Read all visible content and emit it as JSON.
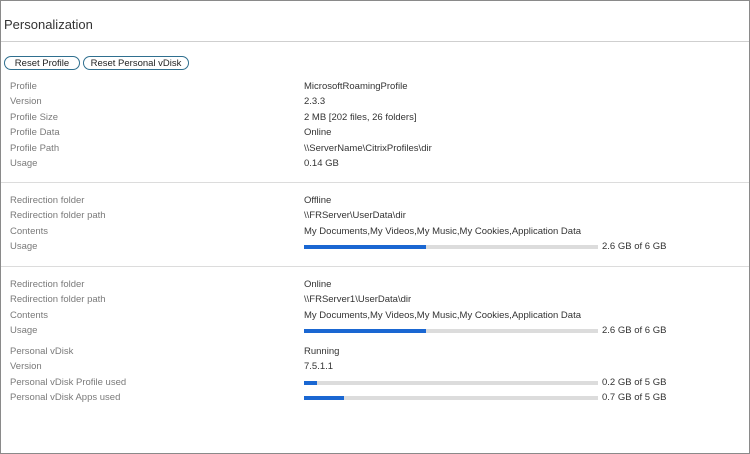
{
  "title": "Personalization",
  "buttons": {
    "reset_profile": "Reset Profile",
    "reset_vdisk": "Reset Personal vDisk"
  },
  "profile": {
    "rows": [
      {
        "label": "Profile",
        "value": "MicrosoftRoamingProfile"
      },
      {
        "label": "Version",
        "value": "2.3.3"
      },
      {
        "label": "Profile Size",
        "value": "2 MB [202 files, 26 folders]"
      },
      {
        "label": "Profile Data",
        "value": "Online"
      },
      {
        "label": "Profile Path",
        "value": "\\\\ServerName\\CitrixProfiles\\dir"
      },
      {
        "label": "Usage",
        "value": "0.14 GB"
      }
    ]
  },
  "redirection1": {
    "rows": [
      {
        "label": "Redirection folder",
        "value": "Offline"
      },
      {
        "label": "Redirection folder path",
        "value": "\\\\FRServer\\UserData\\dir"
      },
      {
        "label": "Contents",
        "value": "My Documents,My Videos,My Music,My Cookies,Application Data"
      }
    ],
    "usage": {
      "label": "Usage",
      "text": "2.6 GB of 6 GB",
      "fraction": 0.415
    }
  },
  "redirection2": {
    "rows": [
      {
        "label": "Redirection folder",
        "value": "Online"
      },
      {
        "label": "Redirection folder path",
        "value": "\\\\FRServer1\\UserData\\dir"
      },
      {
        "label": "Contents",
        "value": "My Documents,My Videos,My Music,My Cookies,Application Data"
      }
    ],
    "usage": {
      "label": "Usage",
      "text": "2.6 GB of 6 GB",
      "fraction": 0.415
    }
  },
  "vdisk": {
    "rows": [
      {
        "label": "Personal vDisk",
        "value": "Running"
      },
      {
        "label": "Version",
        "value": "7.5.1.1"
      }
    ],
    "profile_used": {
      "label": "Personal vDisk Profile used",
      "text": "0.2 GB of 5 GB",
      "fraction": 0.044
    },
    "apps_used": {
      "label": "Personal vDisk Apps used",
      "text": "0.7 GB of 5 GB",
      "fraction": 0.136
    }
  },
  "colors": {
    "bar_fill": "#1a67d2",
    "bar_track": "#dcdcdc",
    "button_border": "#2f6f8f"
  }
}
